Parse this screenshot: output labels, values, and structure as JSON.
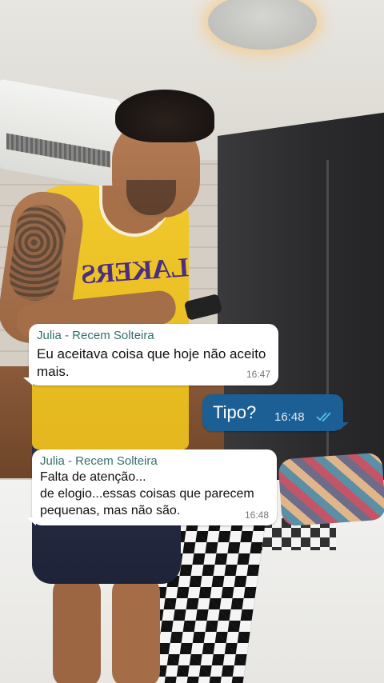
{
  "chat": {
    "messages": [
      {
        "direction": "incoming",
        "sender": "Julia - Recem Solteira",
        "text": "Eu aceitava coisa que hoje não aceito\nmais.",
        "time": "16:47"
      },
      {
        "direction": "outgoing",
        "text": "Tipo?",
        "time": "16:48",
        "status_icon": "double-check-read-icon"
      },
      {
        "direction": "incoming",
        "sender": "Julia - Recem Solteira",
        "text": "Falta de atenção...\nde elogio...essas coisas que parecem\npequenas, mas não são.",
        "time": "16:48"
      }
    ]
  },
  "colors": {
    "incoming_bubble": "#ffffff",
    "outgoing_bubble": "#1b5f94",
    "sender_name": "#36706a",
    "read_ticks": "#53bdeb"
  }
}
